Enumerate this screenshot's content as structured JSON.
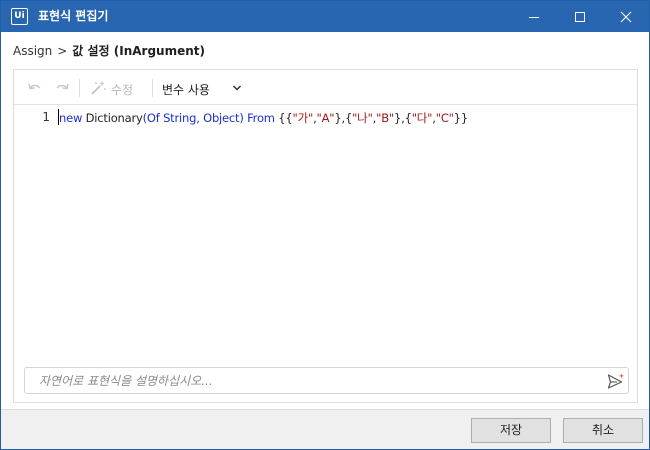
{
  "window": {
    "title": "표현식 편집기",
    "app_logo": "Ui",
    "controls": [
      "minimize-icon",
      "maximize-icon",
      "close-icon"
    ],
    "accent_color": "#2966b1"
  },
  "breadcrumb": {
    "root": "Assign",
    "separator": ">",
    "current": "값 설정 (InArgument)"
  },
  "toolbar": {
    "undo_icon": "undo-icon",
    "redo_icon": "redo-icon",
    "fix_label": "수정",
    "fix_icon": "magic-wand-icon",
    "variables_label": "변수 사용",
    "variables_icon": "chevron-down-icon"
  },
  "editor": {
    "line_number": "1",
    "tokens": [
      {
        "t": "new",
        "c": "kw"
      },
      {
        "t": " Dictionary",
        "c": "plain"
      },
      {
        "t": "(Of String, Object)",
        "c": "kw"
      },
      {
        "t": " From",
        "c": "kw"
      },
      {
        "t": " {{",
        "c": "plain"
      },
      {
        "t": "\"가\"",
        "c": "str"
      },
      {
        "t": ",",
        "c": "plain"
      },
      {
        "t": "\"A\"",
        "c": "str"
      },
      {
        "t": "},{",
        "c": "plain"
      },
      {
        "t": "\"나\"",
        "c": "str"
      },
      {
        "t": ",",
        "c": "plain"
      },
      {
        "t": "\"B\"",
        "c": "str"
      },
      {
        "t": "},{",
        "c": "plain"
      },
      {
        "t": "\"다\"",
        "c": "str"
      },
      {
        "t": ",",
        "c": "plain"
      },
      {
        "t": "\"C\"",
        "c": "str"
      },
      {
        "t": "}}",
        "c": "plain"
      }
    ],
    "colors": {
      "keyword": "#1d2fd0",
      "string": "#a31515",
      "plain": "#1f1f1f"
    }
  },
  "prompt": {
    "placeholder": "자연어로 표현식을 설명하십시오...",
    "value": "",
    "send_icon": "send-sparkle-icon"
  },
  "footer": {
    "save_label": "저장",
    "cancel_label": "취소"
  }
}
